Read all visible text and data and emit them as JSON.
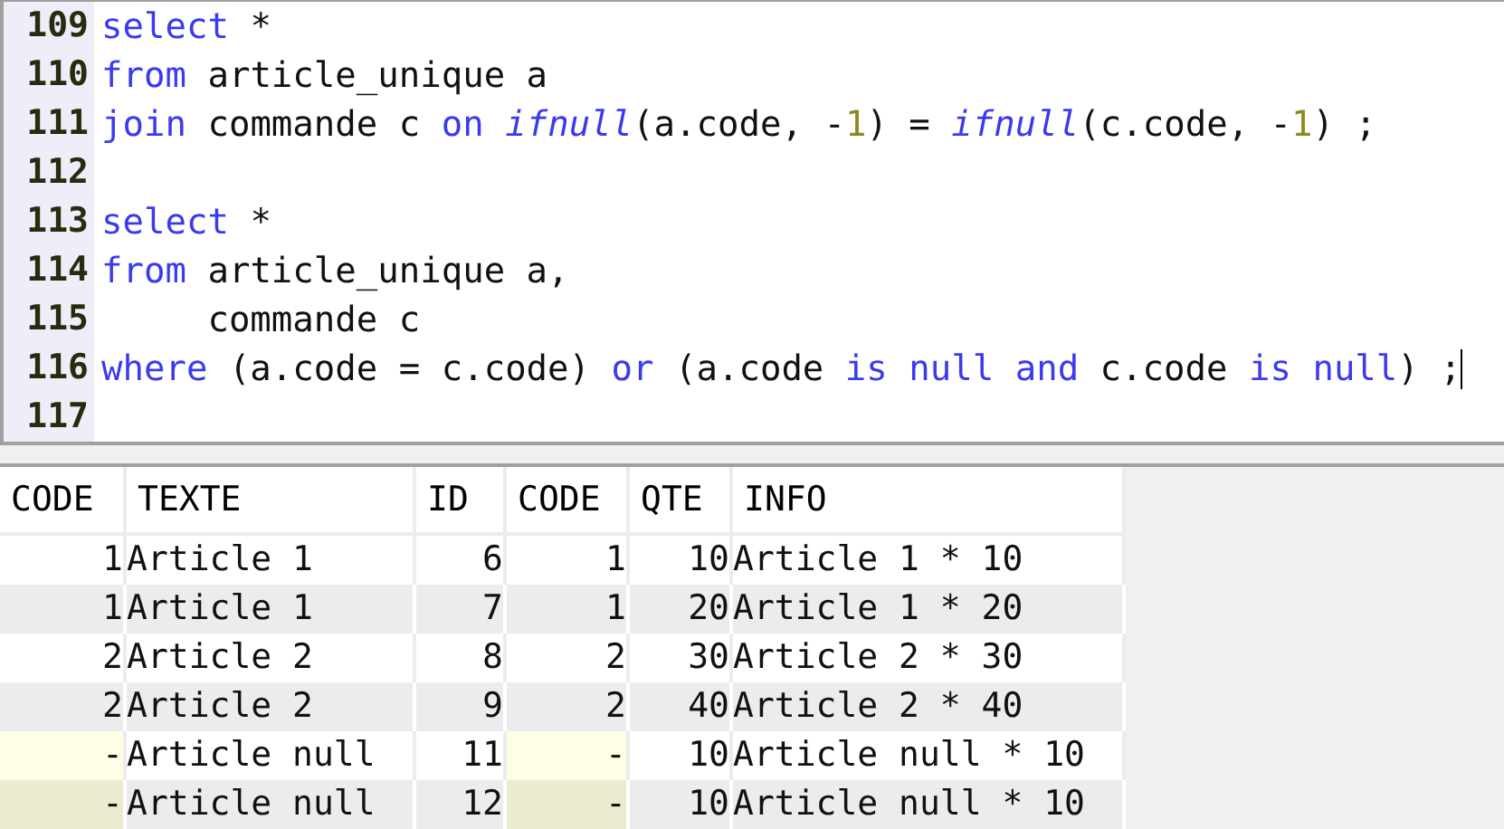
{
  "editor": {
    "lines": [
      {
        "number": "109",
        "tokens": [
          {
            "kind": "keyword",
            "text": "select"
          },
          {
            "kind": "plain",
            "text": " *"
          }
        ]
      },
      {
        "number": "110",
        "tokens": [
          {
            "kind": "keyword",
            "text": "from"
          },
          {
            "kind": "plain",
            "text": " article_unique a"
          }
        ]
      },
      {
        "number": "111",
        "tokens": [
          {
            "kind": "keyword",
            "text": "join"
          },
          {
            "kind": "plain",
            "text": " commande c "
          },
          {
            "kind": "keyword",
            "text": "on "
          },
          {
            "kind": "function",
            "text": "ifnull"
          },
          {
            "kind": "plain",
            "text": "(a.code, -"
          },
          {
            "kind": "number",
            "text": "1"
          },
          {
            "kind": "plain",
            "text": ") = "
          },
          {
            "kind": "function",
            "text": "ifnull"
          },
          {
            "kind": "plain",
            "text": "(c.code, -"
          },
          {
            "kind": "number",
            "text": "1"
          },
          {
            "kind": "plain",
            "text": ") ;"
          }
        ]
      },
      {
        "number": "112"
      },
      {
        "number": "113",
        "tokens": [
          {
            "kind": "keyword",
            "text": "select"
          },
          {
            "kind": "plain",
            "text": " *"
          }
        ]
      },
      {
        "number": "114",
        "tokens": [
          {
            "kind": "keyword",
            "text": "from"
          },
          {
            "kind": "plain",
            "text": " article_unique a,"
          }
        ]
      },
      {
        "number": "115",
        "tokens": [
          {
            "kind": "plain",
            "text": "     commande c"
          }
        ]
      },
      {
        "number": "116",
        "cursor": true,
        "tokens": [
          {
            "kind": "keyword",
            "text": "where"
          },
          {
            "kind": "plain",
            "text": " (a.code = c.code) "
          },
          {
            "kind": "keyword",
            "text": "or"
          },
          {
            "kind": "plain",
            "text": " (a.code "
          },
          {
            "kind": "keyword",
            "text": "is null and"
          },
          {
            "kind": "plain",
            "text": " c.code "
          },
          {
            "kind": "keyword",
            "text": "is null"
          },
          {
            "kind": "plain",
            "text": ") ;"
          }
        ]
      },
      {
        "number": "117"
      }
    ]
  },
  "results": {
    "columns": [
      {
        "label": "CODE",
        "kind": "number"
      },
      {
        "label": "TEXTE",
        "kind": "text"
      },
      {
        "label": "ID",
        "kind": "number"
      },
      {
        "label": "CODE",
        "kind": "number"
      },
      {
        "label": "QTE",
        "kind": "number"
      },
      {
        "label": "INFO",
        "kind": "text"
      }
    ],
    "rows": [
      [
        {
          "text": "1",
          "null": false
        },
        {
          "text": "Article 1",
          "null": false
        },
        {
          "text": "6",
          "null": false
        },
        {
          "text": "1",
          "null": false
        },
        {
          "text": "10",
          "null": false
        },
        {
          "text": "Article 1 * 10",
          "null": false
        }
      ],
      [
        {
          "text": "1",
          "null": false
        },
        {
          "text": "Article 1",
          "null": false
        },
        {
          "text": "7",
          "null": false
        },
        {
          "text": "1",
          "null": false
        },
        {
          "text": "20",
          "null": false
        },
        {
          "text": "Article 1 * 20",
          "null": false
        }
      ],
      [
        {
          "text": "2",
          "null": false
        },
        {
          "text": "Article 2",
          "null": false
        },
        {
          "text": "8",
          "null": false
        },
        {
          "text": "2",
          "null": false
        },
        {
          "text": "30",
          "null": false
        },
        {
          "text": "Article 2 * 30",
          "null": false
        }
      ],
      [
        {
          "text": "2",
          "null": false
        },
        {
          "text": "Article 2",
          "null": false
        },
        {
          "text": "9",
          "null": false
        },
        {
          "text": "2",
          "null": false
        },
        {
          "text": "40",
          "null": false
        },
        {
          "text": "Article 2 * 40",
          "null": false
        }
      ],
      [
        {
          "text": "-",
          "null": true
        },
        {
          "text": "Article null",
          "null": false
        },
        {
          "text": "11",
          "null": false
        },
        {
          "text": "-",
          "null": true
        },
        {
          "text": "10",
          "null": false
        },
        {
          "text": "Article null * 10",
          "null": false
        }
      ],
      [
        {
          "text": "-",
          "null": true
        },
        {
          "text": "Article null",
          "null": false
        },
        {
          "text": "12",
          "null": false
        },
        {
          "text": "-",
          "null": true
        },
        {
          "text": "10",
          "null": false
        },
        {
          "text": "Article null * 10",
          "null": false
        }
      ]
    ]
  }
}
